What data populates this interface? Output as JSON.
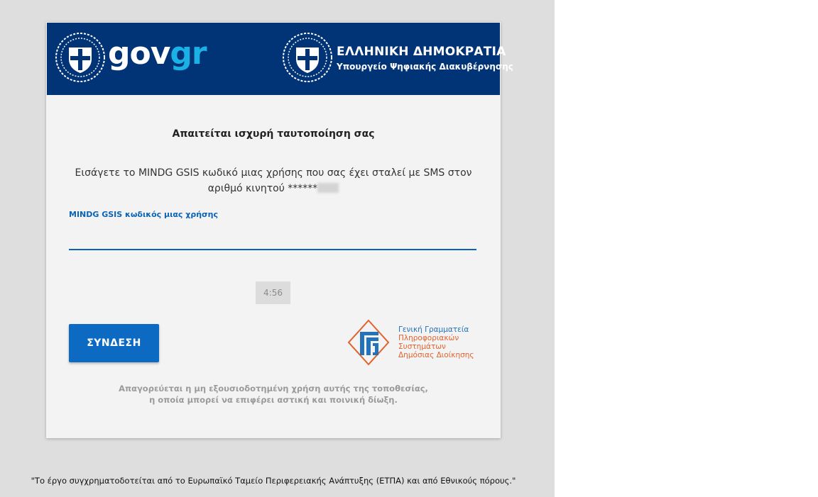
{
  "header": {
    "brand_main": "gov",
    "brand_accent": "gr",
    "ministry_title": "ΕΛΛΗΝΙΚΗ ΔΗΜΟΚΡΑΤΙΑ",
    "ministry_subtitle": "Υπουργείο Ψηφιακής Διακυβέρνησης",
    "background_color": "#003476",
    "accent_color": "#1ab2e6"
  },
  "form": {
    "heading": "Απαιτείται ισχυρή ταυτοποίηση σας",
    "instruction_line1": "Εισάγετε το MINDG GSIS κωδικό μιας χρήσης που σας έχει σταλεί με SMS στον",
    "instruction_line2": "αριθμό κινητού ******",
    "otp_label": "MINDG GSIS κωδικός μιας χρήσης",
    "otp_value": "",
    "timer": "4:56",
    "login_button": "ΣΥΝΔΕΣΗ"
  },
  "gsis_logo": {
    "line1": "Γενική Γραμματεία",
    "line2": "Πληροφοριακών",
    "line3": "Συστημάτων",
    "line4": "Δημόσιας Διοίκησης"
  },
  "disclaimer": {
    "line1": "Απαγορεύεται η μη εξουσιοδοτημένη χρήση αυτής της τοποθεσίας,",
    "line2": "η οποία μπορεί να επιφέρει αστική και ποινική δίωξη."
  },
  "footer": {
    "text": "\"Το έργο συγχρηματοδοτείται από το Ευρωπαϊκό Ταμείο Περιφερειακής Ανάπτυξης (ΕΤΠΑ) και από Εθνικούς πόρους.\""
  },
  "icons": {
    "emblem": "greek-coat-of-arms-icon",
    "gsis": "gsis-logo-icon"
  }
}
